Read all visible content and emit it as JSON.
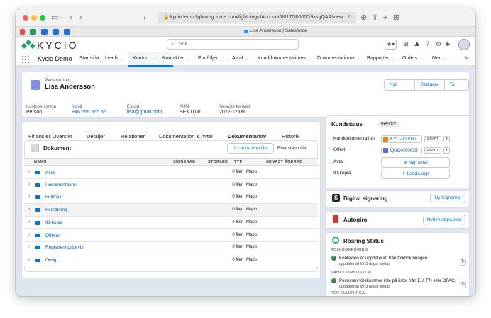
{
  "browser": {
    "url": "kyciodemo.lightning.force.com/lightning/r/Account/0017Q00000i9xsgQAA/view",
    "tab_title": "Lisa Andersson | Salesforce"
  },
  "header": {
    "logo_text": "KYCIO",
    "search_placeholder": "Sök..."
  },
  "nav": {
    "app_name": "Kycio Demo",
    "items": [
      {
        "label": "Startsida",
        "chevron": false
      },
      {
        "label": "Leads",
        "chevron": true
      },
      {
        "label": "Konton",
        "chevron": true,
        "active": true
      },
      {
        "label": "Kontakter",
        "chevron": true
      },
      {
        "label": "Portföljer",
        "chevron": true
      },
      {
        "label": "Avtal",
        "chevron": true
      },
      {
        "label": "Kunddokumentationer",
        "chevron": true
      },
      {
        "label": "Dokumentationer",
        "chevron": true
      },
      {
        "label": "Rapporter",
        "chevron": true
      },
      {
        "label": "Orders",
        "chevron": true
      },
      {
        "label": "Mer",
        "chevron": true
      }
    ]
  },
  "record": {
    "type_label": "Personkonto",
    "name": "Lisa Andersson",
    "actions": [
      "Nytt Uttag",
      "Redigera",
      "Ta bort"
    ],
    "fields": [
      {
        "label": "Kontopersontyp",
        "value": "Person",
        "link": false
      },
      {
        "label": "Mobil",
        "value": "+46 555 555 55",
        "link": true
      },
      {
        "label": "E-post",
        "value": "lisa@gmail.com",
        "link": true
      },
      {
        "label": "AUM",
        "value": "SEK 0,00",
        "link": false
      },
      {
        "label": "Senaste kontakt",
        "value": "2022-12-09",
        "link": false
      }
    ]
  },
  "tabs": [
    "Finansiell Översikt",
    "Detaljer",
    "Relationer",
    "Dokumentation & Avtal",
    "Dokumentarkiv",
    "Historik"
  ],
  "documents": {
    "title": "Dokument",
    "upload_label": "Ladda upp filer",
    "drop_text": "Eller släpp filer",
    "columns": [
      "NAMN",
      "SIGNERAD",
      "STORLEK",
      "TYP",
      "SENAST ÄNDRAD"
    ],
    "rows": [
      {
        "name": "Avtal",
        "size": "0 filer",
        "type": "Mapp"
      },
      {
        "name": "Dokumentation",
        "size": "0 filer",
        "type": "Mapp"
      },
      {
        "name": "Fullmakt",
        "size": "0 filer",
        "type": "Mapp"
      },
      {
        "name": "Försäkring",
        "size": "0 filer",
        "type": "Mapp"
      },
      {
        "name": "ID-kopia",
        "size": "0 filer",
        "type": "Mapp"
      },
      {
        "name": "Offerter",
        "size": "0 filer",
        "type": "Mapp"
      },
      {
        "name": "Registreringsbevis",
        "size": "0 filer",
        "type": "Mapp"
      },
      {
        "name": "Övrigt",
        "size": "0 filer",
        "type": "Mapp"
      }
    ]
  },
  "kundstatus": {
    "title": "Kundstatus",
    "badge": "INAKTIV",
    "rows": [
      {
        "label": "Kunddokumentation",
        "value": "KYC-000037",
        "status": "DRAFT",
        "color": "#f38303"
      },
      {
        "label": "Offert",
        "value": "QUO-000025",
        "status": "DRAFT",
        "color": "#5867e8"
      }
    ],
    "avtal_label": "Avtal",
    "avtal_button": "Nytt avtal",
    "id_label": "ID-kopia",
    "id_button": "Ladda upp"
  },
  "signing": {
    "title": "Digital signering",
    "button": "Ny Signering"
  },
  "autogiro": {
    "title": "Autogiro",
    "button": "Nytt medgivande"
  },
  "roaring": {
    "title": "Roaring Status",
    "sections": [
      {
        "label": "FOLKBOKFÖRING",
        "text": "Kontakten är uppdaterad från folkbokföringen.",
        "sub": "uppdaterad för 3 dagar sedan"
      },
      {
        "label": "SANKTIONSLISTOR",
        "text": "Personen förekommer inte på listor från EU, FN eller OFAC.",
        "sub": "uppdaterad för 3 dagar sedan"
      }
    ],
    "next_label": "PEP ELLER RCA"
  }
}
